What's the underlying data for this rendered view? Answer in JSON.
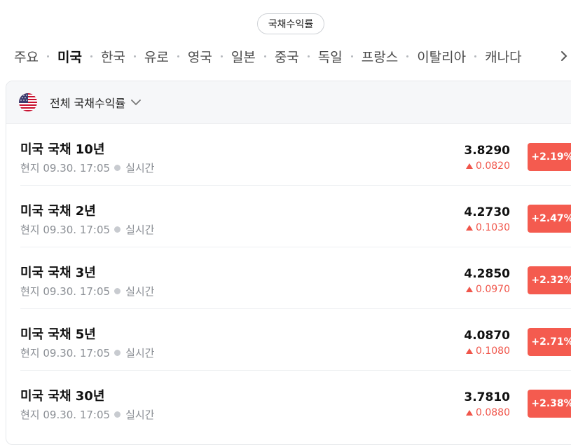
{
  "header": {
    "pill_label": "국채수익률"
  },
  "tabs": [
    {
      "label": "주요",
      "active": false
    },
    {
      "label": "미국",
      "active": true
    },
    {
      "label": "한국",
      "active": false
    },
    {
      "label": "유로",
      "active": false
    },
    {
      "label": "영국",
      "active": false
    },
    {
      "label": "일본",
      "active": false
    },
    {
      "label": "중국",
      "active": false
    },
    {
      "label": "독일",
      "active": false
    },
    {
      "label": "프랑스",
      "active": false
    },
    {
      "label": "이탈리아",
      "active": false
    },
    {
      "label": "캐나다",
      "active": false
    }
  ],
  "filter": {
    "label": "전체 국채수익률",
    "flag_icon": "us-flag-icon"
  },
  "rows": [
    {
      "name": "미국 국채 10년",
      "meta": "현지 09.30. 17:05",
      "live": "실시간",
      "value": "3.8290",
      "change": "0.0820",
      "pct": "+2.19%"
    },
    {
      "name": "미국 국채 2년",
      "meta": "현지 09.30. 17:05",
      "live": "실시간",
      "value": "4.2730",
      "change": "0.1030",
      "pct": "+2.47%"
    },
    {
      "name": "미국 국채 3년",
      "meta": "현지 09.30. 17:05",
      "live": "실시간",
      "value": "4.2850",
      "change": "0.0970",
      "pct": "+2.32%"
    },
    {
      "name": "미국 국채 5년",
      "meta": "현지 09.30. 17:05",
      "live": "실시간",
      "value": "4.0870",
      "change": "0.1080",
      "pct": "+2.71%"
    },
    {
      "name": "미국 국채 30년",
      "meta": "현지 09.30. 17:05",
      "live": "실시간",
      "value": "3.7810",
      "change": "0.0880",
      "pct": "+2.38%"
    }
  ],
  "colors": {
    "up": "#f0554a",
    "badge": "#f45b4f"
  }
}
